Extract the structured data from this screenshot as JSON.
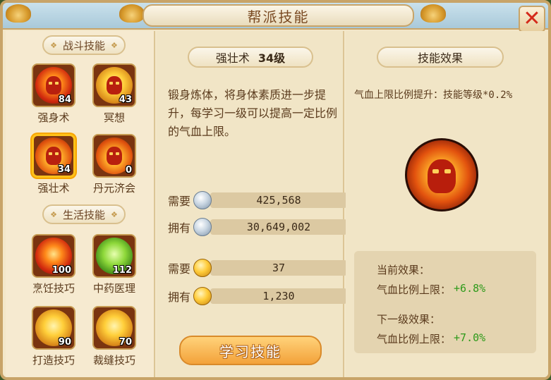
{
  "window": {
    "title": "帮派技能"
  },
  "left": {
    "combat_header": "战斗技能",
    "life_header": "生活技能",
    "combat_skills": [
      {
        "name": "强身术",
        "level": "84",
        "icon": "strength-skill-icon"
      },
      {
        "name": "冥想",
        "level": "43",
        "icon": "meditation-skill-icon"
      },
      {
        "name": "强壮术",
        "level": "34",
        "icon": "vigor-skill-icon",
        "selected": true
      },
      {
        "name": "丹元济会",
        "level": "0",
        "icon": "elixir-skill-icon"
      }
    ],
    "life_skills": [
      {
        "name": "烹饪技巧",
        "level": "100",
        "icon": "cooking-skill-icon"
      },
      {
        "name": "中药医理",
        "level": "112",
        "icon": "herbal-medicine-skill-icon"
      },
      {
        "name": "打造技巧",
        "level": "90",
        "icon": "forging-skill-icon"
      },
      {
        "name": "裁缝技巧",
        "level": "70",
        "icon": "tailoring-skill-icon"
      }
    ]
  },
  "detail": {
    "skill_name": "强壮术",
    "skill_level": "34级",
    "description": "锻身炼体，将身体素质进一步提升，每学习一级可以提高一定比例的气血上限。",
    "silver_need_label": "需要",
    "silver_need": "425,568",
    "silver_have_label": "拥有",
    "silver_have": "30,649,002",
    "gold_need_label": "需要",
    "gold_need": "37",
    "gold_have_label": "拥有",
    "gold_have": "1,230",
    "add_symbol": "+",
    "info_symbol": "i",
    "learn_button": "学习技能"
  },
  "effect": {
    "header": "技能效果",
    "formula": "气血上限比例提升：技能等级*0.2%",
    "current_label": "当前效果：",
    "current_stat": "气血比例上限：",
    "current_value": "+6.8%",
    "next_label": "下一级效果：",
    "next_stat": "气血比例上限：",
    "next_value": "+7.0%"
  },
  "colors": {
    "accent": "#f3a23a",
    "positive": "#2e9a1a",
    "close": "#d42a1a"
  }
}
